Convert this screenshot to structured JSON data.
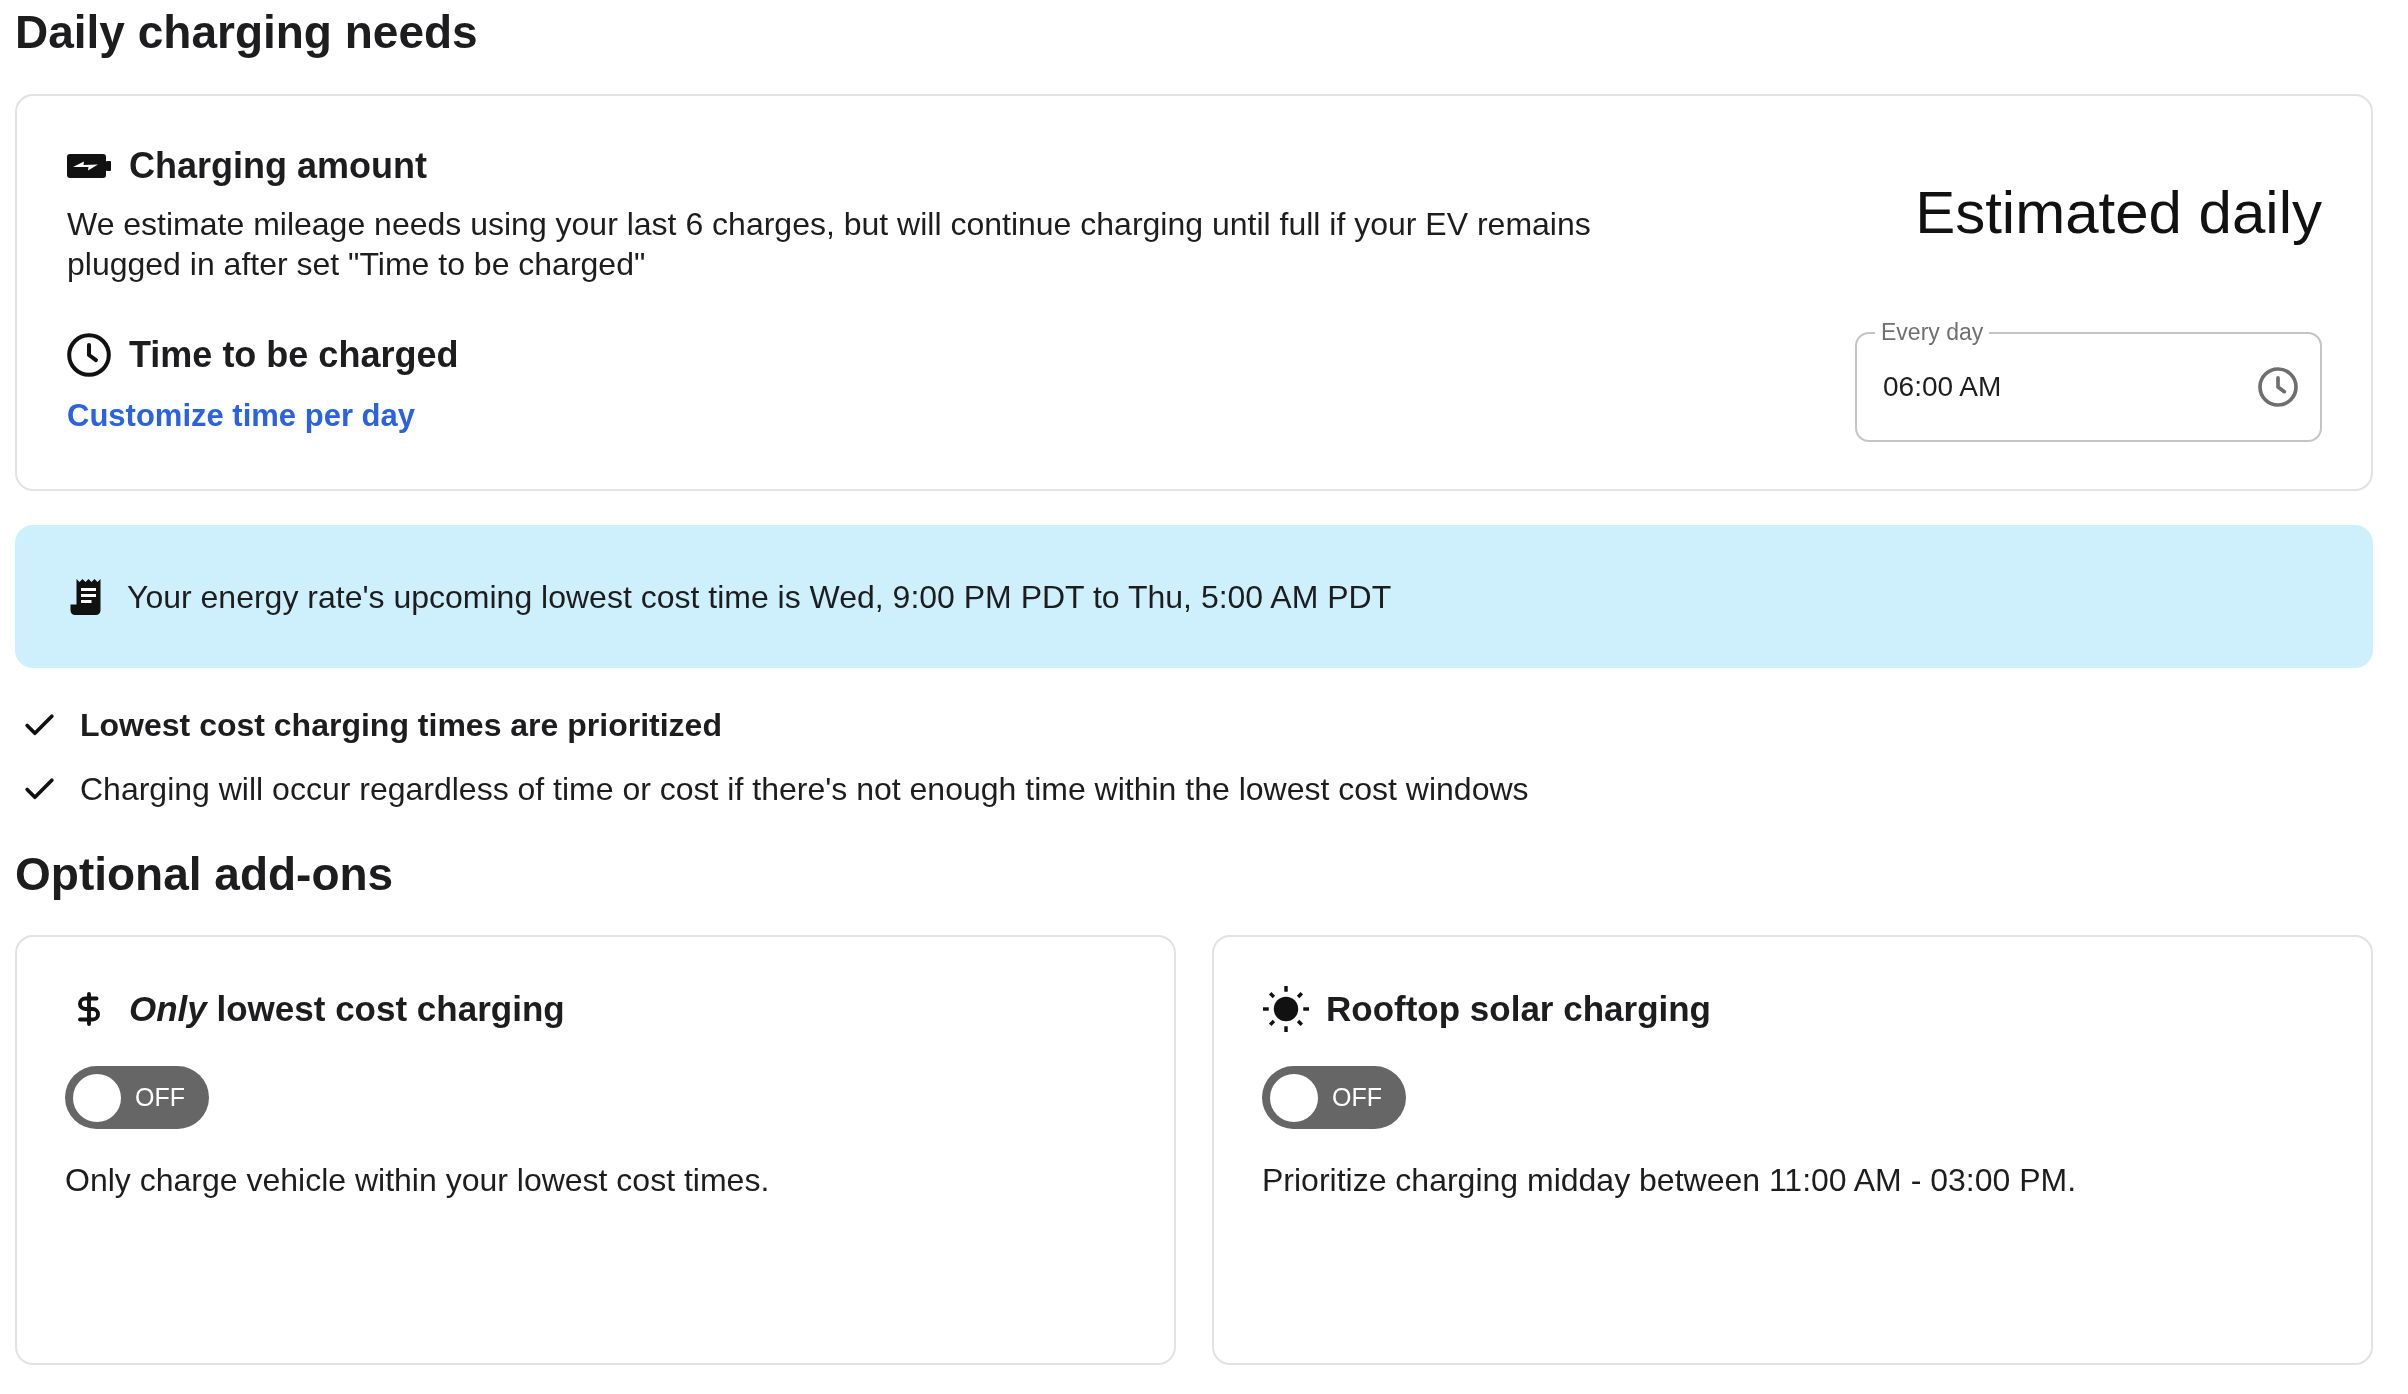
{
  "daily_charging_needs": {
    "heading": "Daily charging needs",
    "charging_amount": {
      "title": "Charging amount",
      "description": "We estimate mileage needs using your last 6 charges, but will continue charging until full if your EV remains plugged in after set \"Time to be charged\""
    },
    "time_to_be_charged": {
      "title": "Time to be charged",
      "link": "Customize time per day"
    },
    "estimate": {
      "title": "Estimated daily",
      "field": {
        "label": "Every day",
        "value": "06:00 AM"
      }
    }
  },
  "rate_banner": {
    "text": "Your energy rate's upcoming lowest cost time is Wed, 9:00 PM PDT to Thu, 5:00 AM PDT"
  },
  "notes": [
    {
      "text": "Lowest cost charging times are prioritized",
      "bold": true
    },
    {
      "text": "Charging will occur regardless of time or cost if there's not enough time within the lowest cost windows",
      "bold": false
    }
  ],
  "optional_addons": {
    "heading": "Optional add-ons",
    "items": [
      {
        "title": "*Only* lowest cost charging",
        "toggle": {
          "on": false,
          "label": "OFF"
        },
        "description": "Only charge vehicle within your lowest cost times."
      },
      {
        "title": "Rooftop solar charging",
        "toggle": {
          "on": false,
          "label": "OFF"
        },
        "description": "Prioritize charging midday between 11:00 AM - 03:00 PM."
      }
    ]
  }
}
